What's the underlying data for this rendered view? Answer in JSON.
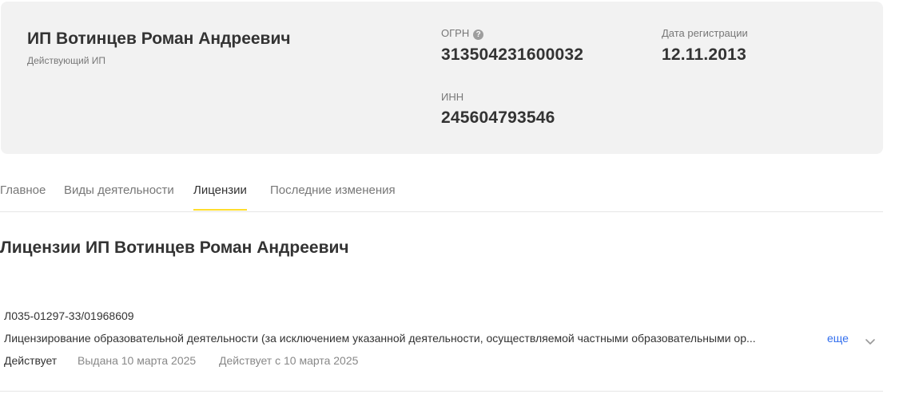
{
  "header": {
    "name": "ИП Вотинцев Роман Андреевич",
    "status": "Действующий ИП",
    "ogrn_label": "ОГРН",
    "ogrn_value": "313504231600032",
    "reg_date_label": "Дата регистрации",
    "reg_date_value": "12.11.2013",
    "inn_label": "ИНН",
    "inn_value": "245604793546"
  },
  "icons": {
    "help": "question-circle-icon",
    "expand": "chevron-down-icon"
  },
  "tabs": [
    {
      "label": "Главное",
      "active": false
    },
    {
      "label": "Виды деятельности",
      "active": false
    },
    {
      "label": "Лицензии",
      "active": true
    },
    {
      "label": "Последние изменения",
      "active": false
    }
  ],
  "section": {
    "title": "Лицензии ИП Вотинцев Роман Андреевич"
  },
  "license": {
    "number": "Л035-01297-33/01968609",
    "description": "Лицензирование образовательной деятельности (за исключением указанной деятельности, осуществляемой частными образовательными ор...",
    "more_label": "еще",
    "status": "Действует",
    "issued": "Выдана 10 марта 2025",
    "valid_from": "Действует с 10 марта 2025"
  },
  "colors": {
    "card_bg": "#f2f2f2",
    "accent_tab": "#ffdd2d",
    "link": "#336fee",
    "muted_text": "#777777",
    "primary_text": "#333333"
  }
}
